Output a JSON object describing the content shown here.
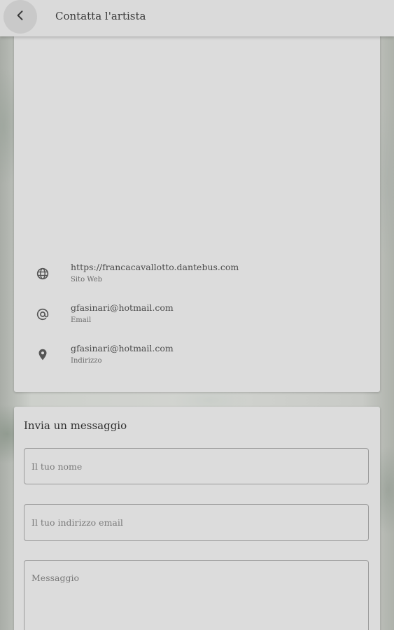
{
  "appbar": {
    "title": "Contatta l'artista",
    "back_icon": "chevron-left-icon"
  },
  "contact_info": {
    "items": [
      {
        "icon": "globe-icon",
        "value": "https://francacavallotto.dantebus.com",
        "label": "Sito Web"
      },
      {
        "icon": "at-icon",
        "value": "gfasinari@hotmail.com",
        "label": "Email"
      },
      {
        "icon": "location-pin-icon",
        "value": "gfasinari@hotmail.com",
        "label": "Indirizzo"
      }
    ]
  },
  "message_form": {
    "title": "Invia un messaggio",
    "name_placeholder": "Il tuo nome",
    "email_placeholder": "Il tuo indirizzo email",
    "message_placeholder": "Messaggio"
  },
  "colors": {
    "card": "#dcdcdc",
    "appbar": "#dadada",
    "icon": "#555555"
  }
}
